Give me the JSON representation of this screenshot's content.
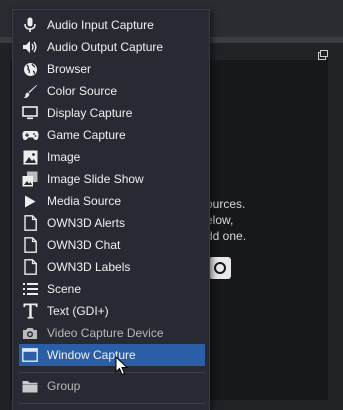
{
  "background": {
    "hint_lines": [
      "ources.",
      "elow,",
      "dd one."
    ]
  },
  "menu": {
    "items": [
      {
        "label": "Audio Input Capture",
        "icon": "microphone-icon"
      },
      {
        "label": "Audio Output Capture",
        "icon": "speaker-icon"
      },
      {
        "label": "Browser",
        "icon": "globe-icon"
      },
      {
        "label": "Color Source",
        "icon": "paintbrush-icon"
      },
      {
        "label": "Display Capture",
        "icon": "monitor-icon"
      },
      {
        "label": "Game Capture",
        "icon": "gamepad-icon"
      },
      {
        "label": "Image",
        "icon": "image-icon"
      },
      {
        "label": "Image Slide Show",
        "icon": "slideshow-icon"
      },
      {
        "label": "Media Source",
        "icon": "play-icon"
      },
      {
        "label": "OWN3D Alerts",
        "icon": "document-icon"
      },
      {
        "label": "OWN3D Chat",
        "icon": "document-icon"
      },
      {
        "label": "OWN3D Labels",
        "icon": "document-icon"
      },
      {
        "label": "Scene",
        "icon": "list-icon"
      },
      {
        "label": "Text (GDI+)",
        "icon": "text-icon"
      },
      {
        "label": "Video Capture Device",
        "icon": "camera-icon"
      },
      {
        "label": "Window Capture",
        "icon": "window-icon",
        "selected": true
      }
    ],
    "group": {
      "label": "Group",
      "icon": "folder-icon"
    }
  },
  "colors": {
    "menu_bg": "#272a33",
    "selected_bg": "#2a5fa8",
    "text": "#f0f0f0"
  }
}
